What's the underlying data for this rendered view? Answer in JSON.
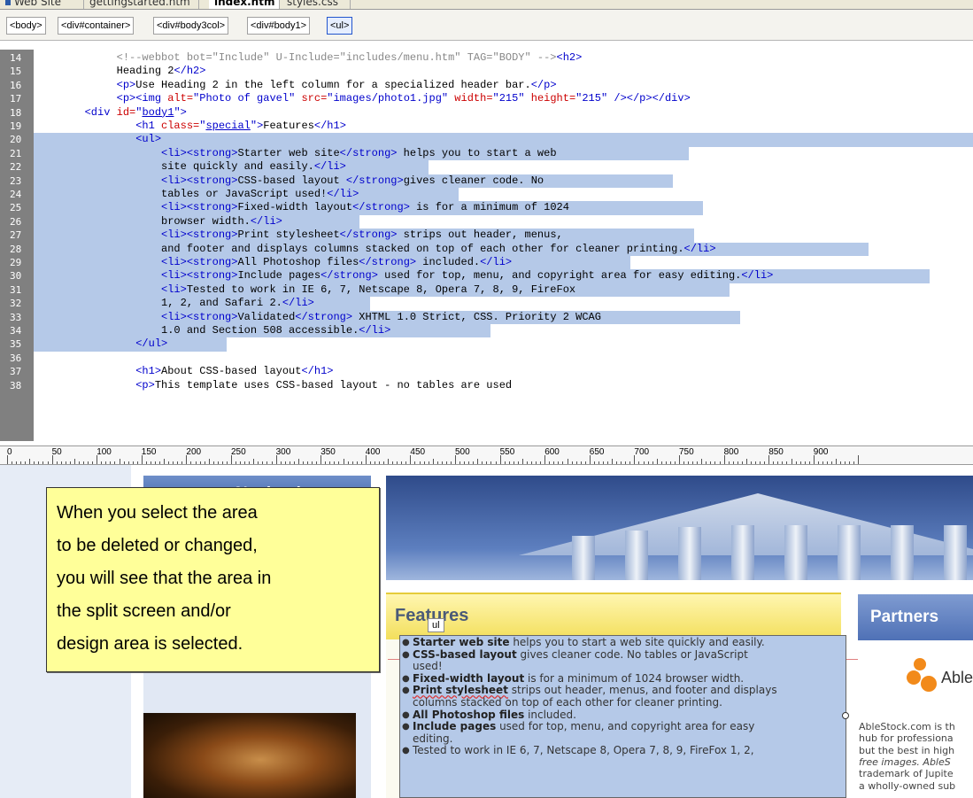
{
  "tabs": [
    "Web Site",
    "gettingstarted.htm",
    "index.htm",
    "styles.css"
  ],
  "tag_selector": [
    "<body>",
    "<div#container>",
    "<div#body3col>",
    "<div#body1>",
    "<ul>"
  ],
  "code": {
    "line_numbers": [
      "14",
      "15",
      "16",
      "17",
      "18",
      "19",
      "20",
      "21",
      "22",
      "23",
      "24",
      "25",
      "26",
      "27",
      "28",
      "29",
      "30",
      "31",
      "32",
      "33",
      "34",
      "35",
      "36",
      "37",
      "38"
    ],
    "l14_comment": "<!--webbot bot=\"Include\" U-Include=\"includes/menu.htm\" TAG=\"BODY\" -->",
    "l14_tag": "<h2>",
    "l15_text": "Heading 2",
    "l15_tag": "</h2>",
    "l16_open": "<p>",
    "l16_text": "Use Heading 2 in the left column for a specialized header bar.",
    "l16_close": "</p>",
    "l17_a": "<p><img ",
    "l17_alt_attr": "alt=",
    "l17_alt_val": "\"Photo of gavel\"",
    "l17_src_attr": " src=",
    "l17_src_val": "\"images/photo1.jpg\"",
    "l17_w_attr": " width=",
    "l17_w_val": "\"215\"",
    "l17_h_attr": " height=",
    "l17_h_val": "\"215\"",
    "l17_end": " /></p></div>",
    "l18_a": "<div ",
    "l18_attr": "id=",
    "l18_q1": "\"",
    "l18_val": "body1",
    "l18_q2": "\">",
    "l19_a": "<h1 ",
    "l19_attr": "class=",
    "l19_q1": "\"",
    "l19_val": "special",
    "l19_q2": "\">",
    "l19_text": "Features",
    "l19_close": "</h1>",
    "l20_tag": "<ul>",
    "l21_a": "<li><strong>",
    "l21_b": "Starter web site",
    "l21_c": "</strong>",
    "l21_d": " helps you to start a web",
    "l22_a": "site quickly and easily.",
    "l22_b": "</li>",
    "l23_a": "<li><strong>",
    "l23_b": "CSS-based layout ",
    "l23_c": "</strong>",
    "l23_d": "gives cleaner code. No",
    "l24_a": "tables or JavaScript used!",
    "l24_b": "</li>",
    "l25_a": "<li><strong>",
    "l25_b": "Fixed-width layout",
    "l25_c": "</strong>",
    "l25_d": " is for a minimum of 1024",
    "l26_a": "browser width.",
    "l26_b": "</li>",
    "l27_a": "<li><strong>",
    "l27_b": "Print stylesheet",
    "l27_c": "</strong>",
    "l27_d": " strips out header, menus,",
    "l28_a": "and footer and displays columns stacked on top of each other for cleaner printing.",
    "l28_b": "</li>",
    "l29_a": "<li><strong>",
    "l29_b": "All Photoshop files",
    "l29_c": "</strong>",
    "l29_d": " included.",
    "l29_e": "</li>",
    "l30_a": "<li><strong>",
    "l30_b": "Include pages",
    "l30_c": "</strong>",
    "l30_d": " used for top, menu, and copyright area for easy editing.",
    "l30_e": "</li>",
    "l31_a": "<li>",
    "l31_b": "Tested to work in IE 6, 7, Netscape 8, Opera 7, 8, 9, FireFox",
    "l32_a": "1, 2, and Safari 2.",
    "l32_b": "</li>",
    "l33_a": "<li><strong>",
    "l33_b": "Validated",
    "l33_c": "</strong>",
    "l33_d": " XHTML 1.0 Strict, CSS. Priority 2 WCAG",
    "l34_a": "1.0 and Section 508 accessible.",
    "l34_b": "</li>",
    "l35_tag": "</ul>",
    "l37_a": "<h1>",
    "l37_b": "About CSS-based layout",
    "l37_c": "</h1>",
    "l38_a": "<p>",
    "l38_b": "This template uses CSS-based layout - no tables are used"
  },
  "ruler_labels": [
    "0",
    "50",
    "100",
    "150",
    "200",
    "250",
    "300",
    "350",
    "400",
    "450",
    "500",
    "550",
    "600",
    "650",
    "700",
    "750",
    "800",
    "850",
    "900"
  ],
  "design": {
    "nav_heading": "Navigation",
    "features_heading": "Features",
    "ul_tag": "ul",
    "items": [
      {
        "bold": "Starter web site",
        "text": " helps you to start a web site quickly and easily."
      },
      {
        "bold": "CSS-based layout",
        "text": " gives cleaner code. No tables or JavaScript"
      },
      {
        "bold": "",
        "text": "used!"
      },
      {
        "bold": "Fixed-width layout",
        "text": " is for a minimum of 1024 browser width."
      },
      {
        "bold": "Print stylesheet",
        "text": " strips out header, menus, and footer and displays"
      },
      {
        "bold": "",
        "text": "columns stacked on top of each other for cleaner printing."
      },
      {
        "bold": "All Photoshop files",
        "text": " included."
      },
      {
        "bold": "Include pages",
        "text": " used for top, menu, and copyright area for easy"
      },
      {
        "bold": "",
        "text": "editing."
      },
      {
        "bold": "",
        "text": "Tested to work in IE 6, 7, Netscape 8, Opera 7, 8, 9, FireFox 1, 2,"
      }
    ],
    "partners_heading": "Partners",
    "able_logo_text": "Able",
    "able_lines": [
      "AbleStock.com is th",
      "hub for professiona",
      "but the best in high",
      "free images. AbleS",
      "trademark of Jupite",
      "a wholly-owned sub"
    ]
  },
  "callout_lines": [
    "When you select the area",
    "to be deleted or changed,",
    "you will see that the area in",
    "the split screen and/or",
    "design area is selected."
  ]
}
